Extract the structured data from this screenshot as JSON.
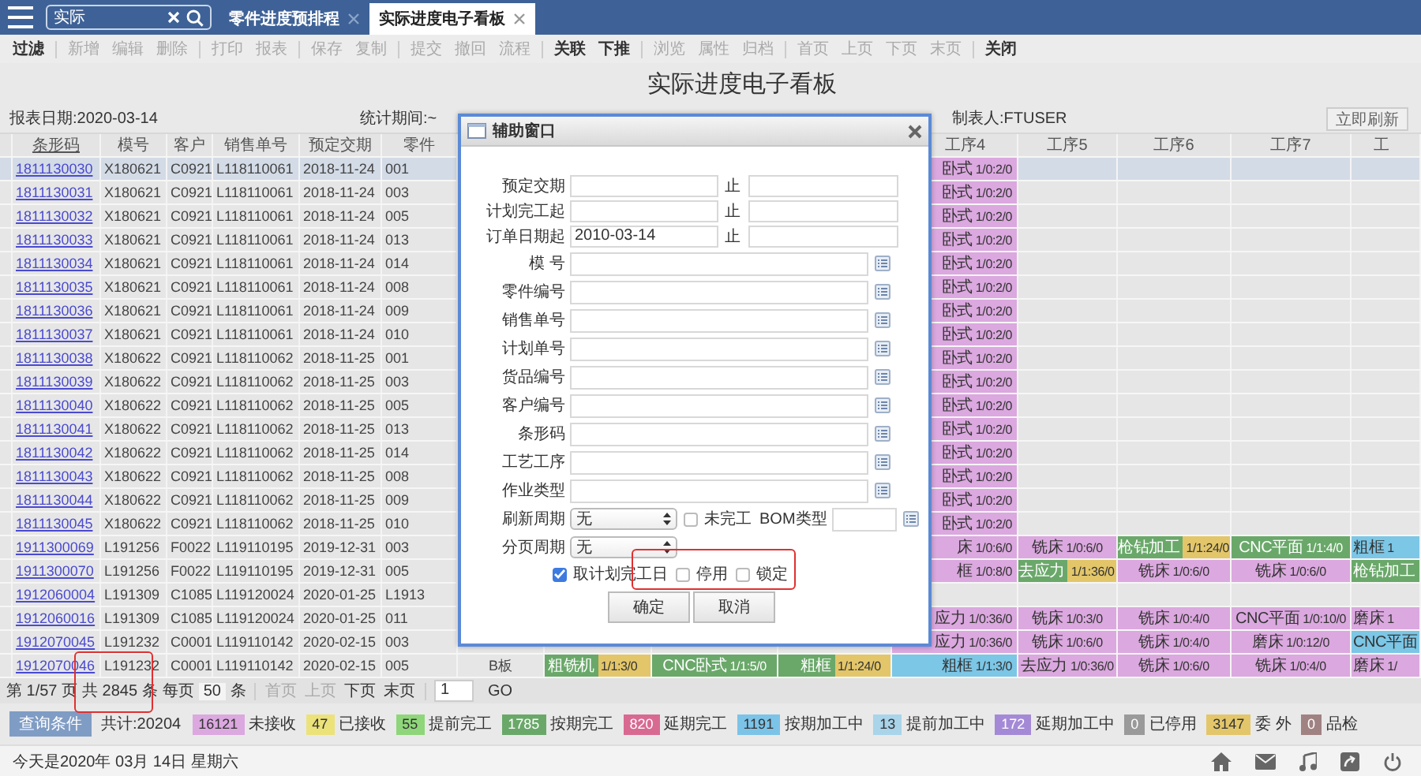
{
  "top_bar": {
    "search": {
      "value": "实际"
    },
    "tabs": [
      {
        "label": "零件进度预排程",
        "selected": false
      },
      {
        "label": "实际进度电子看板",
        "selected": true
      }
    ]
  },
  "toolbar": [
    [
      {
        "label": "过滤",
        "disabled": false
      }
    ],
    [
      {
        "label": "新增",
        "disabled": true
      },
      {
        "label": "编辑",
        "disabled": true
      },
      {
        "label": "删除",
        "disabled": true
      }
    ],
    [
      {
        "label": "打印",
        "disabled": true
      },
      {
        "label": "报表",
        "disabled": true
      }
    ],
    [
      {
        "label": "保存",
        "disabled": true
      },
      {
        "label": "复制",
        "disabled": true
      }
    ],
    [
      {
        "label": "提交",
        "disabled": true
      },
      {
        "label": "撤回",
        "disabled": true
      },
      {
        "label": "流程",
        "disabled": true
      }
    ],
    [
      {
        "label": "关联",
        "disabled": false
      },
      {
        "label": "下推",
        "disabled": false
      }
    ],
    [
      {
        "label": "浏览",
        "disabled": true
      },
      {
        "label": "属性",
        "disabled": true
      },
      {
        "label": "归档",
        "disabled": true
      }
    ],
    [
      {
        "label": "首页",
        "disabled": true
      },
      {
        "label": "上页",
        "disabled": true
      },
      {
        "label": "下页",
        "disabled": true
      },
      {
        "label": "末页",
        "disabled": true
      }
    ],
    [
      {
        "label": "关闭",
        "disabled": false
      }
    ]
  ],
  "report": {
    "title": "实际进度电子看板",
    "report_date": "报表日期:2020-03-14",
    "period": "统计期间:~",
    "maker": "制表人:FTUSER",
    "refresh_button": "立即刷新"
  },
  "table": {
    "columns": [
      "条形码",
      "模号",
      "客户",
      "销售单号",
      "预定交期",
      "零件"
    ],
    "step_columns": [
      "工序4",
      "工序5",
      "工序6",
      "工序7",
      "工"
    ],
    "rows": [
      {
        "barcode": "1811130030",
        "mold": "X180621",
        "customer": "C0921",
        "sales_no": "L118110061",
        "due": "2018-11-24",
        "part": "001",
        "selected": true,
        "steps": [
          {
            "name": "卧式",
            "counts": "1/0:2/0",
            "color": "#dba8df"
          }
        ]
      },
      {
        "barcode": "1811130031",
        "mold": "X180621",
        "customer": "C0921",
        "sales_no": "L118110061",
        "due": "2018-11-24",
        "part": "003",
        "selected": false,
        "steps": [
          {
            "name": "卧式",
            "counts": "1/0:2/0",
            "color": "#dba8df"
          }
        ]
      },
      {
        "barcode": "1811130032",
        "mold": "X180621",
        "customer": "C0921",
        "sales_no": "L118110061",
        "due": "2018-11-24",
        "part": "005",
        "selected": false,
        "steps": [
          {
            "name": "卧式",
            "counts": "1/0:2/0",
            "color": "#dba8df"
          }
        ]
      },
      {
        "barcode": "1811130033",
        "mold": "X180621",
        "customer": "C0921",
        "sales_no": "L118110061",
        "due": "2018-11-24",
        "part": "013",
        "selected": false,
        "steps": [
          {
            "name": "卧式",
            "counts": "1/0:2/0",
            "color": "#dba8df"
          }
        ]
      },
      {
        "barcode": "1811130034",
        "mold": "X180621",
        "customer": "C0921",
        "sales_no": "L118110061",
        "due": "2018-11-24",
        "part": "014",
        "selected": false,
        "steps": [
          {
            "name": "卧式",
            "counts": "1/0:2/0",
            "color": "#dba8df"
          }
        ]
      },
      {
        "barcode": "1811130035",
        "mold": "X180621",
        "customer": "C0921",
        "sales_no": "L118110061",
        "due": "2018-11-24",
        "part": "008",
        "selected": false,
        "steps": [
          {
            "name": "卧式",
            "counts": "1/0:2/0",
            "color": "#dba8df"
          }
        ]
      },
      {
        "barcode": "1811130036",
        "mold": "X180621",
        "customer": "C0921",
        "sales_no": "L118110061",
        "due": "2018-11-24",
        "part": "009",
        "selected": false,
        "steps": [
          {
            "name": "卧式",
            "counts": "1/0:2/0",
            "color": "#dba8df"
          }
        ]
      },
      {
        "barcode": "1811130037",
        "mold": "X180621",
        "customer": "C0921",
        "sales_no": "L118110061",
        "due": "2018-11-24",
        "part": "010",
        "selected": false,
        "steps": [
          {
            "name": "卧式",
            "counts": "1/0:2/0",
            "color": "#dba8df"
          }
        ]
      },
      {
        "barcode": "1811130038",
        "mold": "X180622",
        "customer": "C0921",
        "sales_no": "L118110062",
        "due": "2018-11-25",
        "part": "001",
        "selected": false,
        "steps": [
          {
            "name": "卧式",
            "counts": "1/0:2/0",
            "color": "#dba8df"
          }
        ]
      },
      {
        "barcode": "1811130039",
        "mold": "X180622",
        "customer": "C0921",
        "sales_no": "L118110062",
        "due": "2018-11-25",
        "part": "003",
        "selected": false,
        "steps": [
          {
            "name": "卧式",
            "counts": "1/0:2/0",
            "color": "#dba8df"
          }
        ]
      },
      {
        "barcode": "1811130040",
        "mold": "X180622",
        "customer": "C0921",
        "sales_no": "L118110062",
        "due": "2018-11-25",
        "part": "005",
        "selected": false,
        "steps": [
          {
            "name": "卧式",
            "counts": "1/0:2/0",
            "color": "#dba8df"
          }
        ]
      },
      {
        "barcode": "1811130041",
        "mold": "X180622",
        "customer": "C0921",
        "sales_no": "L118110062",
        "due": "2018-11-25",
        "part": "013",
        "selected": false,
        "steps": [
          {
            "name": "卧式",
            "counts": "1/0:2/0",
            "color": "#dba8df"
          }
        ]
      },
      {
        "barcode": "1811130042",
        "mold": "X180622",
        "customer": "C0921",
        "sales_no": "L118110062",
        "due": "2018-11-25",
        "part": "014",
        "selected": false,
        "steps": [
          {
            "name": "卧式",
            "counts": "1/0:2/0",
            "color": "#dba8df"
          }
        ]
      },
      {
        "barcode": "1811130043",
        "mold": "X180622",
        "customer": "C0921",
        "sales_no": "L118110062",
        "due": "2018-11-25",
        "part": "008",
        "selected": false,
        "steps": [
          {
            "name": "卧式",
            "counts": "1/0:2/0",
            "color": "#dba8df"
          }
        ]
      },
      {
        "barcode": "1811130044",
        "mold": "X180622",
        "customer": "C0921",
        "sales_no": "L118110062",
        "due": "2018-11-25",
        "part": "009",
        "selected": false,
        "steps": [
          {
            "name": "卧式",
            "counts": "1/0:2/0",
            "color": "#dba8df"
          }
        ]
      },
      {
        "barcode": "1811130045",
        "mold": "X180622",
        "customer": "C0921",
        "sales_no": "L118110062",
        "due": "2018-11-25",
        "part": "010",
        "selected": false,
        "steps": [
          {
            "name": "卧式",
            "counts": "1/0:2/0",
            "color": "#dba8df"
          }
        ]
      },
      {
        "barcode": "1911300069",
        "mold": "L191256",
        "customer": "F0022",
        "sales_no": "L119110195",
        "due": "2019-12-31",
        "part": "003",
        "selected": false,
        "steps": [
          {
            "name": "床",
            "counts": "1/0:6/0",
            "color": "#dba8df"
          },
          {
            "name": "铣床",
            "counts": "1/0:6/0",
            "color": "#dba8df"
          },
          {
            "name": "枪钻加工",
            "counts": "1/1:24/0",
            "color": "#6aa86a",
            "counts_band": {
              "color": "#e3c66a"
            }
          },
          {
            "name": "CNC平面",
            "counts": "1/1:4/0",
            "color": "#6aa86a"
          },
          {
            "name": "粗框",
            "counts": "1",
            "color": "#7cc6e6"
          }
        ]
      },
      {
        "barcode": "1911300070",
        "mold": "L191256",
        "customer": "F0022",
        "sales_no": "L119110195",
        "due": "2019-12-31",
        "part": "005",
        "selected": false,
        "steps": [
          {
            "name": "框",
            "counts": "1/0:8/0",
            "color": "#dba8df"
          },
          {
            "name": "去应力",
            "counts": "1/1:36/0",
            "color": "#6aa86a",
            "counts_band": {
              "color": "#e3c66a"
            }
          },
          {
            "name": "铣床",
            "counts": "1/0:6/0",
            "color": "#dba8df"
          },
          {
            "name": "铣床",
            "counts": "1/0:6/0",
            "color": "#dba8df"
          },
          {
            "name": "枪钻加工",
            "color": "#6aa86a"
          }
        ]
      },
      {
        "barcode": "1912060004",
        "mold": "L191309",
        "customer": "C1085",
        "sales_no": "L119120024",
        "due": "2020-01-25",
        "part": "L1913",
        "selected": false
      },
      {
        "barcode": "1912060016",
        "mold": "L191309",
        "customer": "C1085",
        "sales_no": "L119120024",
        "due": "2020-01-25",
        "part": "011",
        "selected": false,
        "steps": [
          {
            "name": "应力",
            "counts": "1/0:36/0",
            "color": "#dba8df"
          },
          {
            "name": "铣床",
            "counts": "1/0:3/0",
            "color": "#dba8df"
          },
          {
            "name": "铣床",
            "counts": "1/0:4/0",
            "color": "#dba8df"
          },
          {
            "name": "CNC平面",
            "counts": "1/0:10/0",
            "color": "#dba8df"
          },
          {
            "name": "磨床",
            "counts": "1",
            "color": "#dba8df"
          }
        ]
      },
      {
        "barcode": "1912070045",
        "mold": "L191232",
        "customer": "C0001",
        "sales_no": "L119110142",
        "due": "2020-02-15",
        "part": "003",
        "selected": false,
        "steps": [
          {
            "name": "应力",
            "counts": "1/0:36/0",
            "color": "#dba8df"
          },
          {
            "name": "铣床",
            "counts": "1/0:6/0",
            "color": "#dba8df"
          },
          {
            "name": "铣床",
            "counts": "1/0:4/0",
            "color": "#dba8df"
          },
          {
            "name": "磨床",
            "counts": "1/0:12/0",
            "color": "#dba8df"
          },
          {
            "name": "CNC平面",
            "color": "#7cc6e6"
          }
        ]
      },
      {
        "barcode": "1912070046",
        "mold": "L191232",
        "customer": "C0001",
        "sales_no": "L119110142",
        "due": "2020-02-15",
        "part": "005",
        "selected": false,
        "col_8": "B板",
        "early_steps": [
          {
            "name": "粗铣机",
            "counts": "1/1:3/0",
            "color": "#6aa86a",
            "counts_band": {
              "color": "#e3c66a"
            }
          },
          {
            "name": "CNC卧式",
            "counts": "1/1:5/0",
            "color": "#6aa86a"
          },
          {
            "name": "粗框",
            "counts": "1/1:24/0",
            "color": "#6aa86a",
            "counts_band": {
              "color": "#e3c66a"
            }
          }
        ],
        "steps": [
          {
            "name": "粗框",
            "counts": "1/1:3/0",
            "color": "#7cc6e6"
          },
          {
            "name": "去应力",
            "counts": "1/0:36/0",
            "color": "#dba8df"
          },
          {
            "name": "铣床",
            "counts": "1/0:6/0",
            "color": "#dba8df"
          },
          {
            "name": "铣床",
            "counts": "1/0:4/0",
            "color": "#dba8df"
          },
          {
            "name": "磨床",
            "counts": "1/",
            "color": "#dba8df"
          }
        ]
      }
    ]
  },
  "pagination": {
    "page": "第 1/57 页",
    "total": "共 2845 条",
    "per_page_label": "每页",
    "per_page": "50",
    "per_page_unit": "条",
    "nav": [
      {
        "label": "首页",
        "disabled": true
      },
      {
        "label": "上页",
        "disabled": true
      },
      {
        "label": "下页",
        "disabled": false
      },
      {
        "label": "末页",
        "disabled": false
      }
    ],
    "page_input": "1",
    "go": "GO"
  },
  "legend": {
    "query_button": "查询条件",
    "total": "共计:20204",
    "items": [
      {
        "count": "16121",
        "label": "未接收",
        "color": "#dba8df"
      },
      {
        "count": "47",
        "label": "已接收",
        "color": "#ece27a"
      },
      {
        "count": "55",
        "label": "提前完工",
        "color": "#8fd67a"
      },
      {
        "count": "1785",
        "label": "按期完工",
        "color": "#6aa86a"
      },
      {
        "count": "820",
        "label": "延期完工",
        "color": "#d86a92"
      },
      {
        "count": "1191",
        "label": "按期加工中",
        "color": "#7cc3e8"
      },
      {
        "count": "13",
        "label": "提前加工中",
        "color": "#a9d4ea"
      },
      {
        "count": "172",
        "label": "延期加工中",
        "color": "#a48ad6"
      },
      {
        "count": "0",
        "label": "已停用",
        "color": "#9a9a9a"
      },
      {
        "count": "3147",
        "label": "委 外",
        "color": "#e3c66a"
      },
      {
        "count": "0",
        "label": "品检",
        "color": "#a08282"
      }
    ]
  },
  "status_bar": {
    "date": "今天是2020年 03月 14日 星期六"
  },
  "dialog": {
    "title": "辅助窗口",
    "date_rows": [
      {
        "label": "预定交期",
        "to_label": "止"
      },
      {
        "label": "计划完工起",
        "to_label": "止"
      },
      {
        "label": "订单日期起",
        "value": "2010-03-14",
        "to_label": "止"
      }
    ],
    "lookup_rows": [
      {
        "label": "模 号"
      },
      {
        "label": "零件编号"
      },
      {
        "label": "销售单号"
      },
      {
        "label": "计划单号"
      },
      {
        "label": "货品编号"
      },
      {
        "label": "客户编号"
      },
      {
        "label": "条形码"
      },
      {
        "label": "工艺工序"
      },
      {
        "label": "作业类型"
      }
    ],
    "refresh": {
      "label": "刷新周期",
      "value": "无"
    },
    "unfinished": {
      "label": "未完工",
      "checked": false
    },
    "bom_label": "BOM类型",
    "page_cycle": {
      "label": "分页周期",
      "value": "无"
    },
    "checks": [
      {
        "label": "取计划完工日",
        "checked": true
      },
      {
        "label": "停用",
        "checked": false
      },
      {
        "label": "锁定",
        "checked": false
      }
    ],
    "buttons": [
      "确定",
      "取消"
    ]
  }
}
